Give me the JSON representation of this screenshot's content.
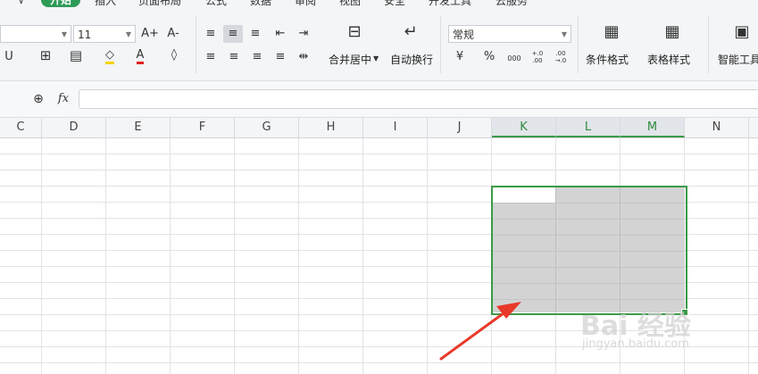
{
  "tabs": [
    {
      "label": "开始",
      "active": true
    },
    {
      "label": "插入"
    },
    {
      "label": "页面布局"
    },
    {
      "label": "公式"
    },
    {
      "label": "数据"
    },
    {
      "label": "审阅"
    },
    {
      "label": "视图"
    },
    {
      "label": "安全"
    },
    {
      "label": "开发工具"
    },
    {
      "label": "云服务"
    }
  ],
  "ribbon": {
    "font_size": "11",
    "font_grow": "A+",
    "font_shrink": "A-",
    "merge_label": "合并居中",
    "wrap_label": "自动换行",
    "number_format": "常规",
    "percent": "%",
    "thousands": "000",
    "inc_decimal": "+.0 .00",
    "dec_decimal": ".00 →.0",
    "cond_format_label": "条件格式",
    "table_style_label": "表格样式",
    "smart_tools_label": "智能工具"
  },
  "formula_bar": {
    "fx": "fx",
    "value": ""
  },
  "columns": [
    "C",
    "D",
    "E",
    "F",
    "G",
    "H",
    "I",
    "J",
    "K",
    "L",
    "M",
    "N"
  ],
  "selected_columns": [
    "K",
    "L",
    "M"
  ],
  "selection": {
    "start": "K3",
    "end": "M10"
  },
  "watermark": {
    "main": "Bai 经验",
    "sub": "jingyan.baidu.com"
  },
  "colors": {
    "accent": "#2e9b57",
    "selection": "#3b9a47",
    "arrow": "#e8392a"
  }
}
